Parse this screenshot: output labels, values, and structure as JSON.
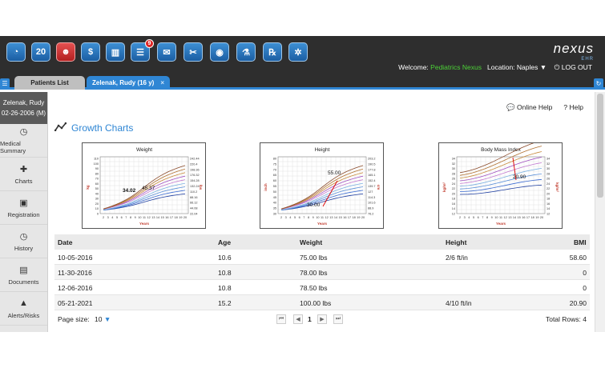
{
  "toolbar": {
    "icons": [
      {
        "name": "dashboard-icon",
        "glyph": "◔"
      },
      {
        "name": "calendar-icon",
        "glyph": "20"
      },
      {
        "name": "patients-icon",
        "glyph": "☻"
      },
      {
        "name": "billing-icon",
        "glyph": "$"
      },
      {
        "name": "reports-icon",
        "glyph": "▥"
      },
      {
        "name": "tasks-icon",
        "glyph": "☰",
        "badge": "9"
      },
      {
        "name": "messages-icon",
        "glyph": "✉"
      },
      {
        "name": "tools-icon",
        "glyph": "✂"
      },
      {
        "name": "camera-icon",
        "glyph": "◉"
      },
      {
        "name": "lab-icon",
        "glyph": "⚗"
      },
      {
        "name": "rx-icon",
        "glyph": "℞"
      },
      {
        "name": "settings-icon",
        "glyph": "✲"
      }
    ]
  },
  "header": {
    "logo": "nexus",
    "logo_sub": "EHR",
    "welcome_label": "Welcome:",
    "user": "Pediatrics Nexus",
    "location_label": "Location: Naples",
    "logout": "LOG OUT"
  },
  "tabs": {
    "patients_list": "Patients List",
    "patient": "Zelenak, Rudy (16 y)",
    "close": "×"
  },
  "patient": {
    "name": "Zelenak, Rudy",
    "dob": "02-26-2006 (M)"
  },
  "sidebar": {
    "items": [
      {
        "label": "Medical Summary",
        "icon": "clock-icon",
        "glyph": "◷"
      },
      {
        "label": "Charts",
        "icon": "medkit-icon",
        "glyph": "✚"
      },
      {
        "label": "Registration",
        "icon": "id-card-icon",
        "glyph": "▣"
      },
      {
        "label": "History",
        "icon": "history-icon",
        "glyph": "◷"
      },
      {
        "label": "Documents",
        "icon": "documents-icon",
        "glyph": "▤"
      },
      {
        "label": "Alerts/Risks",
        "icon": "alert-icon",
        "glyph": "▲"
      }
    ]
  },
  "main": {
    "online_help": "Online Help",
    "help": "Help",
    "title": "Growth Charts"
  },
  "charts": [
    {
      "title": "Weight",
      "ylabel_left": "kg",
      "ylabel_right": "lbs",
      "xlabel": "Years",
      "yticks_left": [
        "110",
        "100",
        "90",
        "80",
        "70",
        "60",
        "50",
        "40",
        "30",
        "20",
        "10",
        "0"
      ],
      "yticks_right": [
        "242.44",
        "220.4",
        "198.36",
        "176.32",
        "154.28",
        "132.24",
        "110.2",
        "88.16",
        "66.12",
        "44.08",
        "22.04"
      ],
      "xticks": [
        "2",
        "3",
        "4",
        "5",
        "6",
        "7",
        "8",
        "9",
        "10",
        "11",
        "12",
        "13",
        "14",
        "15",
        "16",
        "17",
        "18",
        "19",
        "20"
      ],
      "annotations": [
        "34.02",
        "45.37"
      ]
    },
    {
      "title": "Height",
      "ylabel_left": "inch",
      "ylabel_right": "cm",
      "xlabel": "Years",
      "yticks_left": [
        "80",
        "75",
        "70",
        "65",
        "60",
        "55",
        "50",
        "45",
        "40",
        "35",
        "30"
      ],
      "yticks_right": [
        "203.2",
        "190.5",
        "177.8",
        "165.1",
        "152.4",
        "139.7",
        "127",
        "114.3",
        "101.6",
        "88.9",
        "76.2"
      ],
      "xticks": [
        "2",
        "3",
        "4",
        "5",
        "6",
        "7",
        "8",
        "9",
        "10",
        "11",
        "12",
        "13",
        "14",
        "15",
        "16",
        "17",
        "18",
        "19",
        "20"
      ],
      "annotations": [
        "55.00",
        "30.00"
      ]
    },
    {
      "title": "Body Mass Index",
      "ylabel_left": "kg/m²",
      "ylabel_right": "kg/m²",
      "xlabel": "Years",
      "yticks_left": [
        "34",
        "32",
        "30",
        "28",
        "26",
        "24",
        "22",
        "20",
        "18",
        "16",
        "14",
        "12"
      ],
      "yticks_right": [
        "34",
        "32",
        "30",
        "28",
        "26",
        "24",
        "22",
        "20",
        "18",
        "16",
        "14",
        "12"
      ],
      "xticks": [
        "2",
        "3",
        "4",
        "5",
        "6",
        "7",
        "8",
        "9",
        "10",
        "11",
        "12",
        "13",
        "14",
        "15",
        "16",
        "17",
        "18",
        "19",
        "20"
      ],
      "annotations": [
        "20.90"
      ]
    }
  ],
  "table": {
    "columns": [
      "Date",
      "Age",
      "Weight",
      "Height",
      "BMI"
    ],
    "rows": [
      [
        "10-05-2016",
        "10.6",
        "75.00 lbs",
        "2/6 ft/in",
        "58.60"
      ],
      [
        "11-30-2016",
        "10.8",
        "78.00 lbs",
        "",
        "0"
      ],
      [
        "12-06-2016",
        "10.8",
        "78.50 lbs",
        "",
        "0"
      ],
      [
        "05-21-2021",
        "15.2",
        "100.00 lbs",
        "4/10 ft/in",
        "20.90"
      ]
    ]
  },
  "pager": {
    "page_size_label": "Page size:",
    "page_size": "10",
    "first": "⏮",
    "prev": "◀",
    "current": "1",
    "next": "▶",
    "last": "⏭",
    "total_rows": "Total Rows: 4"
  }
}
